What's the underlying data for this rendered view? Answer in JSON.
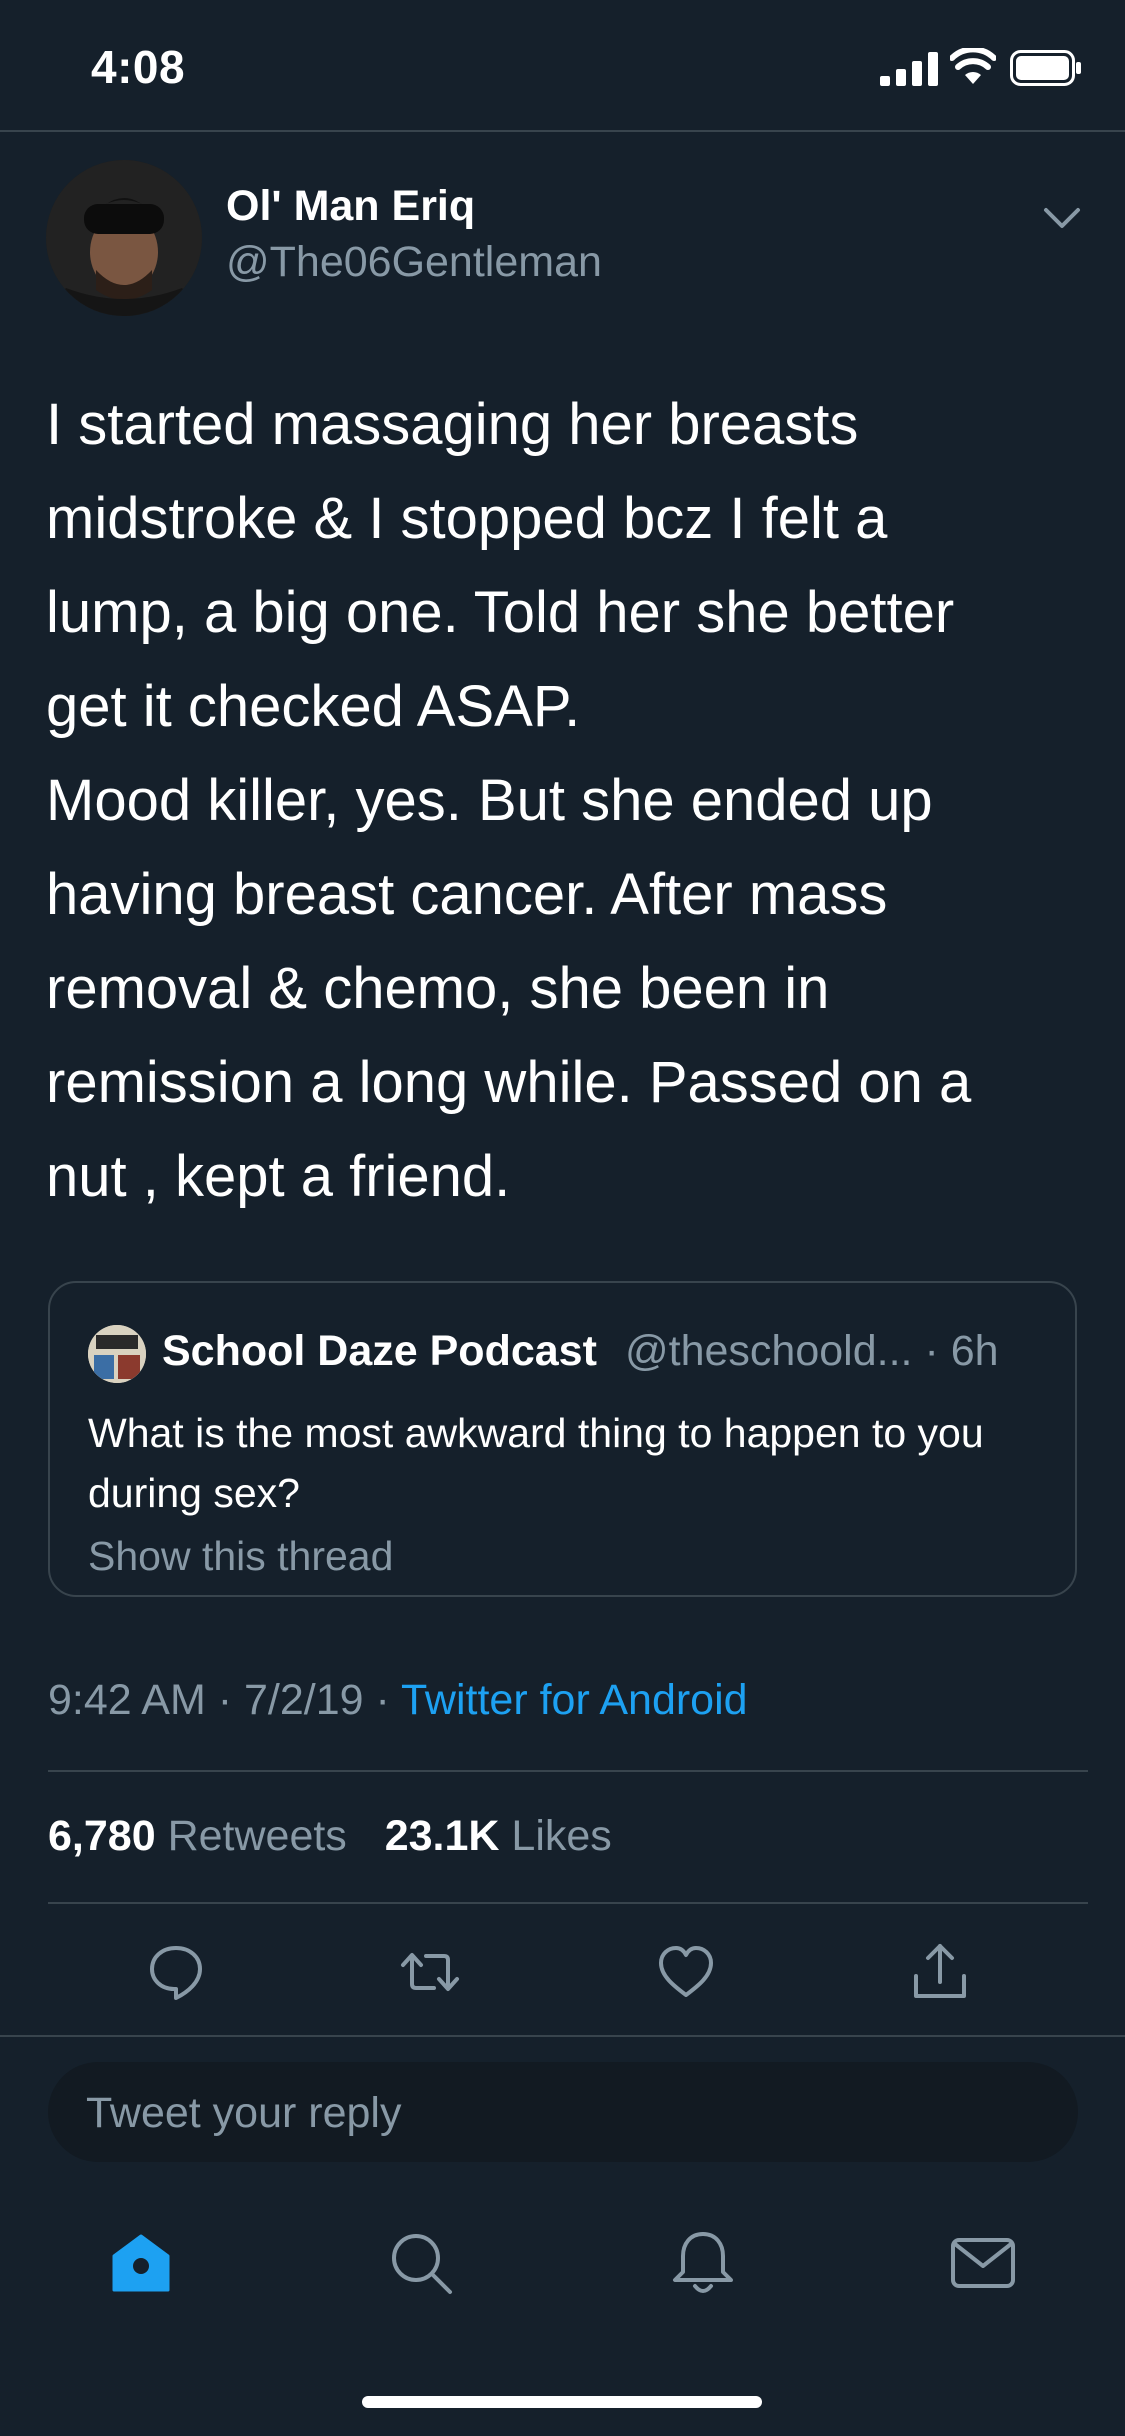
{
  "status_bar": {
    "time": "4:08"
  },
  "tweet": {
    "display_name": "Ol' Man Eriq",
    "username": "@The06Gentleman",
    "text": "I started massaging her breasts\nmidstroke & I stopped bcz I felt a\nlump, a big one. Told her she better\nget it checked ASAP.\nMood killer, yes. But she ended up\nhaving breast cancer. After mass\nremoval & chemo, she been in\nremission a long while. Passed on a\nnut , kept a friend.",
    "quote": {
      "name": "School Daze Podcast",
      "handle": "@theschoold...",
      "separator": "·",
      "age": "6h",
      "text": "What is the most awkward thing to happen to you during sex?",
      "show_thread": "Show this thread"
    },
    "time": "9:42 AM",
    "date": "7/2/19",
    "dot": "·",
    "source": "Twitter for Android",
    "retweets_count": "6,780",
    "retweets_label": "Retweets",
    "likes_count": "23.1K",
    "likes_label": "Likes"
  },
  "reply": {
    "placeholder": "Tweet your reply"
  },
  "tab_bar": {
    "active": "home"
  },
  "colors": {
    "background": "#15202b",
    "accent": "#1da1f2",
    "muted": "#8899a6",
    "border": "#38444d"
  }
}
